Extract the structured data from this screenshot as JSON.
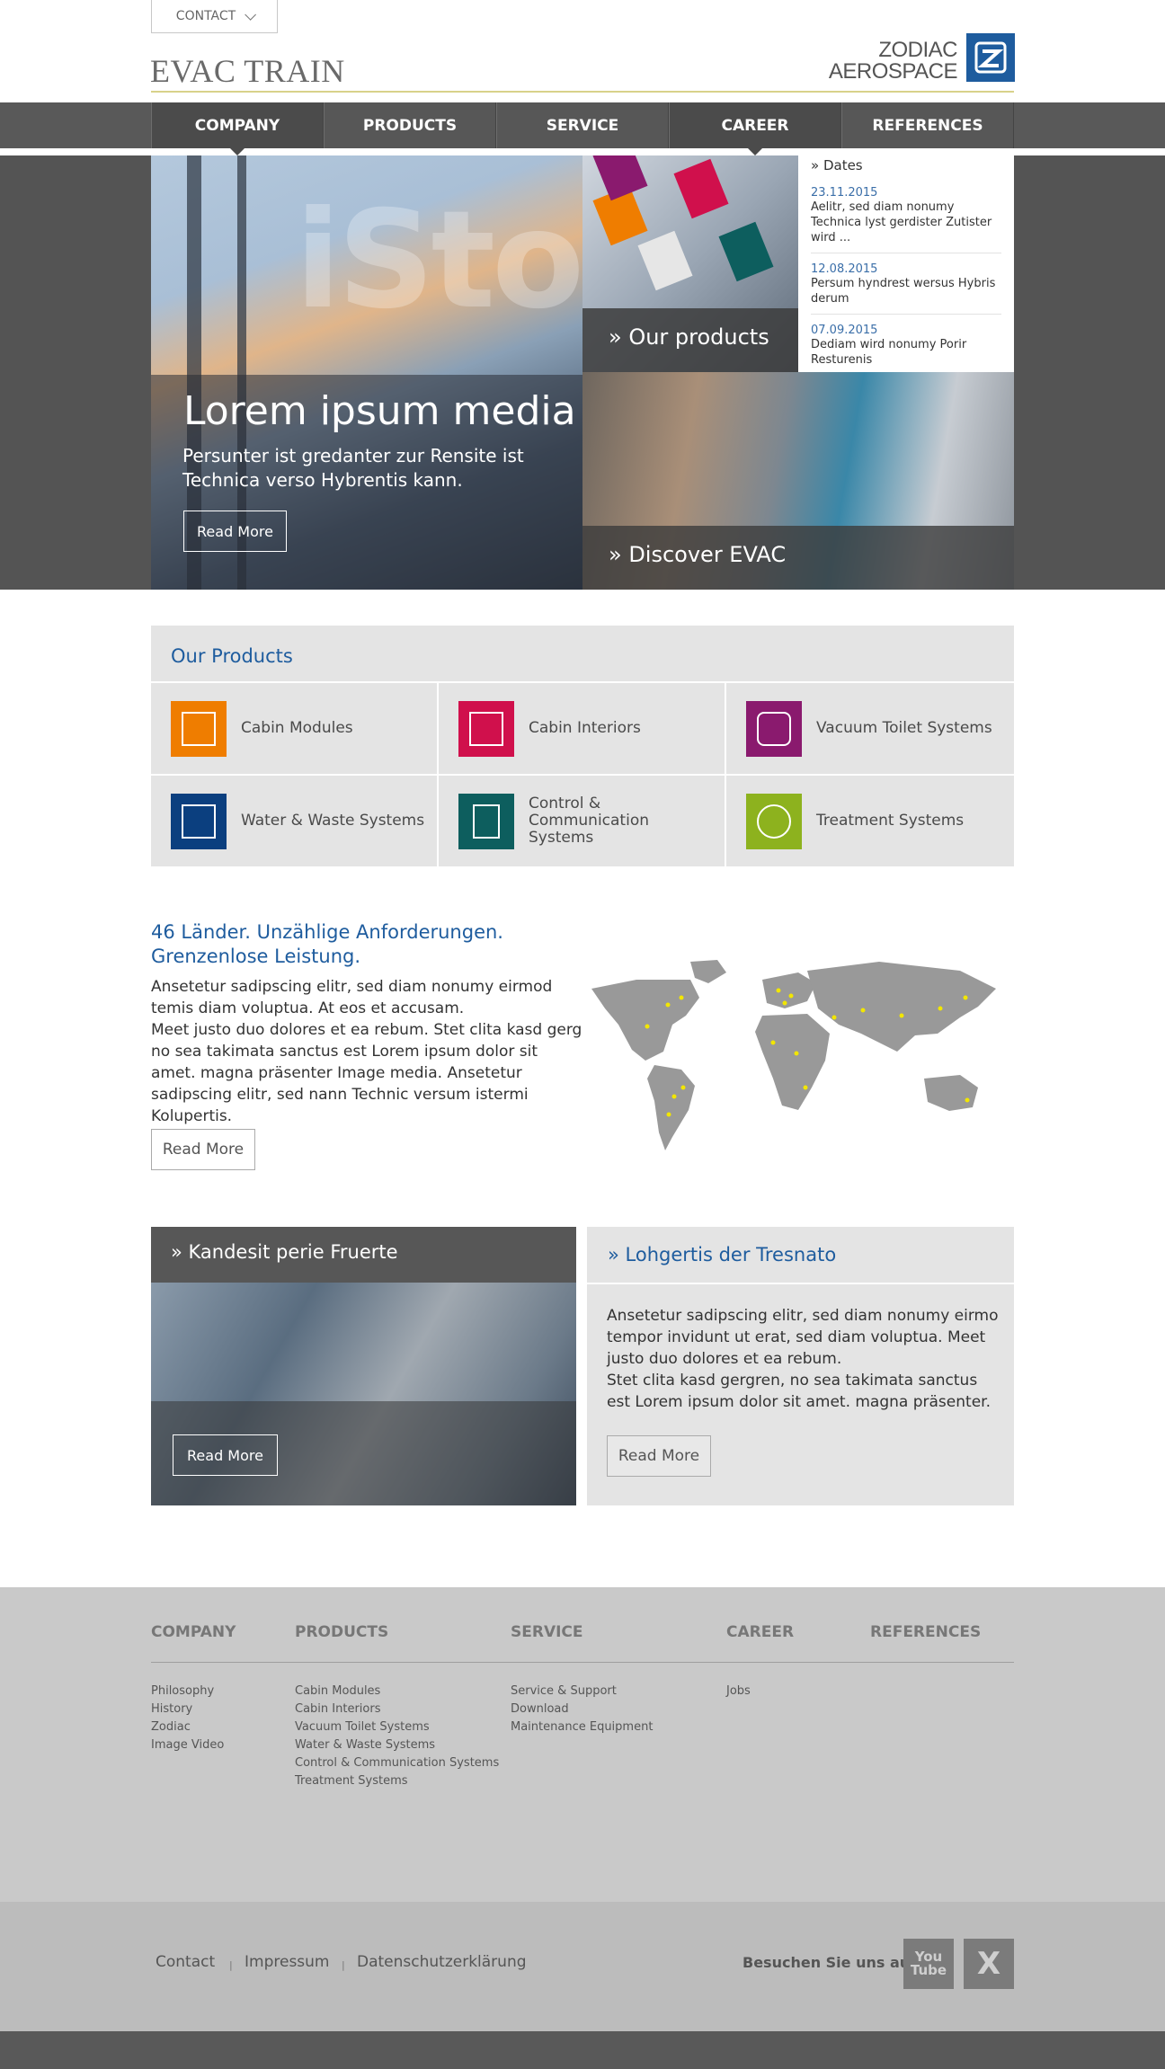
{
  "header": {
    "contact_label": "CONTACT",
    "brand": "EVAC TRAIN",
    "logo_line1": "ZODIAC",
    "logo_line2": "AEROSPACE"
  },
  "nav": [
    {
      "label": "COMPANY",
      "active": true
    },
    {
      "label": "PRODUCTS",
      "active": false
    },
    {
      "label": "SERVICE",
      "active": false
    },
    {
      "label": "CAREER",
      "active": true
    },
    {
      "label": "REFERENCES",
      "active": false
    }
  ],
  "hero": {
    "watermark": "iSto",
    "title": "Lorem ipsum media",
    "subtitle": "Persunter ist gredanter zur Rensite ist Technica verso Hybrentis kann.",
    "button": "Read More",
    "tile_products": "» Our products",
    "tile_discover": "» Discover EVAC"
  },
  "dates": {
    "heading": "» Dates",
    "entries": [
      {
        "date": "23.11.2015",
        "text": "Aelitr, sed diam nonumy Technica lyst gerdister Zutister wird ..."
      },
      {
        "date": "12.08.2015",
        "text": "Persum hyndrest wersus Hybris derum"
      },
      {
        "date": "07.09.2015",
        "text": "Dediam wird nonumy Porir Resturenis"
      }
    ]
  },
  "products": {
    "title": "Our Products",
    "items": [
      {
        "label": "Cabin Modules",
        "color": "#ef7d00"
      },
      {
        "label": "Cabin Interiors",
        "color": "#d0104c"
      },
      {
        "label": "Vacuum Toilet Systems",
        "color": "#8a1a6e"
      },
      {
        "label": "Water & Waste Systems",
        "color": "#0b3f7f"
      },
      {
        "label": "Control & Communication Systems",
        "color": "#0d5e5e"
      },
      {
        "label": "Treatment Systems",
        "color": "#8db21e"
      }
    ]
  },
  "world": {
    "title": "46 Länder. Unzählige Anforderungen. Grenzenlose Leistung.",
    "text_1": "Ansetetur sadipscing elitr, sed diam nonumy eirmod temis diam voluptua. At eos et accusam.",
    "text_2": "Meet justo duo dolores et ea rebum. Stet clita kasd gerg no sea takimata sanctus est Lorem ipsum dolor sit amet. magna präsenter Image media. Ansetetur sadipscing elitr, sed nann Technic versum istermi Kolupertis.",
    "button": "Read More"
  },
  "panel_left": {
    "title": "» Kandesit perie Fruerte",
    "button": "Read More"
  },
  "panel_right": {
    "title": "» Lohgertis der Tresnato",
    "text_1": "Ansetetur sadipscing elitr, sed diam nonumy eirmo tempor invidunt ut erat, sed diam voluptua. Meet justo duo dolores et ea rebum.",
    "text_2": "Stet clita kasd gergren, no sea takimata sanctus est Lorem ipsum dolor sit amet. magna präsenter.",
    "button": "Read More"
  },
  "footer": {
    "columns": [
      {
        "heading": "COMPANY",
        "links": [
          "Philosophy",
          "History",
          "Zodiac",
          "Image Video"
        ]
      },
      {
        "heading": "PRODUCTS",
        "links": [
          "Cabin Modules",
          "Cabin Interiors",
          "Vacuum Toilet Systems",
          "Water & Waste Systems",
          "Control & Communication Systems",
          "Treatment Systems"
        ]
      },
      {
        "heading": "SERVICE",
        "links": [
          "Service & Support",
          "Download",
          "Maintenance Equipment"
        ]
      },
      {
        "heading": "CAREER",
        "links": [
          "Jobs"
        ]
      },
      {
        "heading": "REFERENCES",
        "links": []
      }
    ],
    "bottom_links": [
      "Contact",
      "Impressum",
      "Datenschutzerklärung"
    ],
    "separator": "|",
    "visit": "Besuchen Sie uns auf",
    "youtube_line1": "You",
    "youtube_line2": "Tube",
    "xing": "X"
  }
}
